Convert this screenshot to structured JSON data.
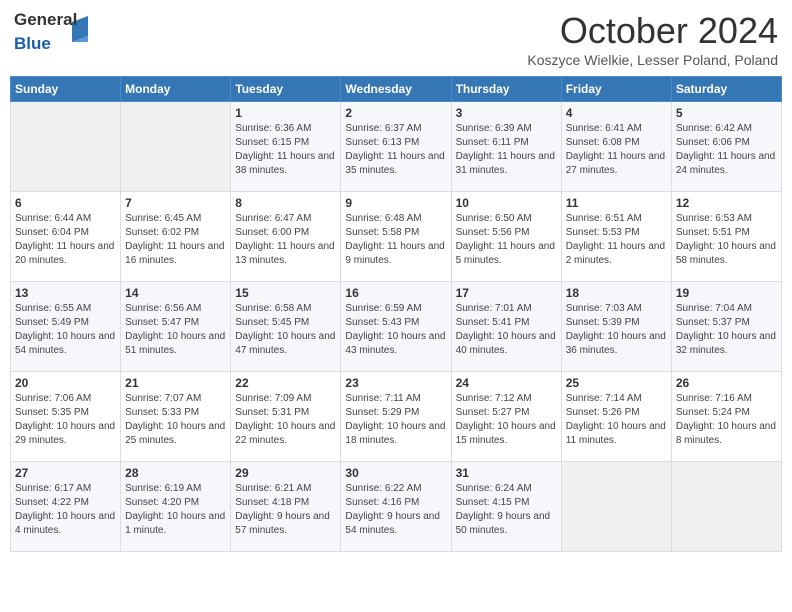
{
  "logo": {
    "general": "General",
    "blue": "Blue"
  },
  "header": {
    "month": "October 2024",
    "location": "Koszyce Wielkie, Lesser Poland, Poland"
  },
  "weekdays": [
    "Sunday",
    "Monday",
    "Tuesday",
    "Wednesday",
    "Thursday",
    "Friday",
    "Saturday"
  ],
  "weeks": [
    [
      {
        "day": "",
        "sunrise": "",
        "sunset": "",
        "daylight": ""
      },
      {
        "day": "",
        "sunrise": "",
        "sunset": "",
        "daylight": ""
      },
      {
        "day": "1",
        "sunrise": "Sunrise: 6:36 AM",
        "sunset": "Sunset: 6:15 PM",
        "daylight": "Daylight: 11 hours and 38 minutes."
      },
      {
        "day": "2",
        "sunrise": "Sunrise: 6:37 AM",
        "sunset": "Sunset: 6:13 PM",
        "daylight": "Daylight: 11 hours and 35 minutes."
      },
      {
        "day": "3",
        "sunrise": "Sunrise: 6:39 AM",
        "sunset": "Sunset: 6:11 PM",
        "daylight": "Daylight: 11 hours and 31 minutes."
      },
      {
        "day": "4",
        "sunrise": "Sunrise: 6:41 AM",
        "sunset": "Sunset: 6:08 PM",
        "daylight": "Daylight: 11 hours and 27 minutes."
      },
      {
        "day": "5",
        "sunrise": "Sunrise: 6:42 AM",
        "sunset": "Sunset: 6:06 PM",
        "daylight": "Daylight: 11 hours and 24 minutes."
      }
    ],
    [
      {
        "day": "6",
        "sunrise": "Sunrise: 6:44 AM",
        "sunset": "Sunset: 6:04 PM",
        "daylight": "Daylight: 11 hours and 20 minutes."
      },
      {
        "day": "7",
        "sunrise": "Sunrise: 6:45 AM",
        "sunset": "Sunset: 6:02 PM",
        "daylight": "Daylight: 11 hours and 16 minutes."
      },
      {
        "day": "8",
        "sunrise": "Sunrise: 6:47 AM",
        "sunset": "Sunset: 6:00 PM",
        "daylight": "Daylight: 11 hours and 13 minutes."
      },
      {
        "day": "9",
        "sunrise": "Sunrise: 6:48 AM",
        "sunset": "Sunset: 5:58 PM",
        "daylight": "Daylight: 11 hours and 9 minutes."
      },
      {
        "day": "10",
        "sunrise": "Sunrise: 6:50 AM",
        "sunset": "Sunset: 5:56 PM",
        "daylight": "Daylight: 11 hours and 5 minutes."
      },
      {
        "day": "11",
        "sunrise": "Sunrise: 6:51 AM",
        "sunset": "Sunset: 5:53 PM",
        "daylight": "Daylight: 11 hours and 2 minutes."
      },
      {
        "day": "12",
        "sunrise": "Sunrise: 6:53 AM",
        "sunset": "Sunset: 5:51 PM",
        "daylight": "Daylight: 10 hours and 58 minutes."
      }
    ],
    [
      {
        "day": "13",
        "sunrise": "Sunrise: 6:55 AM",
        "sunset": "Sunset: 5:49 PM",
        "daylight": "Daylight: 10 hours and 54 minutes."
      },
      {
        "day": "14",
        "sunrise": "Sunrise: 6:56 AM",
        "sunset": "Sunset: 5:47 PM",
        "daylight": "Daylight: 10 hours and 51 minutes."
      },
      {
        "day": "15",
        "sunrise": "Sunrise: 6:58 AM",
        "sunset": "Sunset: 5:45 PM",
        "daylight": "Daylight: 10 hours and 47 minutes."
      },
      {
        "day": "16",
        "sunrise": "Sunrise: 6:59 AM",
        "sunset": "Sunset: 5:43 PM",
        "daylight": "Daylight: 10 hours and 43 minutes."
      },
      {
        "day": "17",
        "sunrise": "Sunrise: 7:01 AM",
        "sunset": "Sunset: 5:41 PM",
        "daylight": "Daylight: 10 hours and 40 minutes."
      },
      {
        "day": "18",
        "sunrise": "Sunrise: 7:03 AM",
        "sunset": "Sunset: 5:39 PM",
        "daylight": "Daylight: 10 hours and 36 minutes."
      },
      {
        "day": "19",
        "sunrise": "Sunrise: 7:04 AM",
        "sunset": "Sunset: 5:37 PM",
        "daylight": "Daylight: 10 hours and 32 minutes."
      }
    ],
    [
      {
        "day": "20",
        "sunrise": "Sunrise: 7:06 AM",
        "sunset": "Sunset: 5:35 PM",
        "daylight": "Daylight: 10 hours and 29 minutes."
      },
      {
        "day": "21",
        "sunrise": "Sunrise: 7:07 AM",
        "sunset": "Sunset: 5:33 PM",
        "daylight": "Daylight: 10 hours and 25 minutes."
      },
      {
        "day": "22",
        "sunrise": "Sunrise: 7:09 AM",
        "sunset": "Sunset: 5:31 PM",
        "daylight": "Daylight: 10 hours and 22 minutes."
      },
      {
        "day": "23",
        "sunrise": "Sunrise: 7:11 AM",
        "sunset": "Sunset: 5:29 PM",
        "daylight": "Daylight: 10 hours and 18 minutes."
      },
      {
        "day": "24",
        "sunrise": "Sunrise: 7:12 AM",
        "sunset": "Sunset: 5:27 PM",
        "daylight": "Daylight: 10 hours and 15 minutes."
      },
      {
        "day": "25",
        "sunrise": "Sunrise: 7:14 AM",
        "sunset": "Sunset: 5:26 PM",
        "daylight": "Daylight: 10 hours and 11 minutes."
      },
      {
        "day": "26",
        "sunrise": "Sunrise: 7:16 AM",
        "sunset": "Sunset: 5:24 PM",
        "daylight": "Daylight: 10 hours and 8 minutes."
      }
    ],
    [
      {
        "day": "27",
        "sunrise": "Sunrise: 6:17 AM",
        "sunset": "Sunset: 4:22 PM",
        "daylight": "Daylight: 10 hours and 4 minutes."
      },
      {
        "day": "28",
        "sunrise": "Sunrise: 6:19 AM",
        "sunset": "Sunset: 4:20 PM",
        "daylight": "Daylight: 10 hours and 1 minute."
      },
      {
        "day": "29",
        "sunrise": "Sunrise: 6:21 AM",
        "sunset": "Sunset: 4:18 PM",
        "daylight": "Daylight: 9 hours and 57 minutes."
      },
      {
        "day": "30",
        "sunrise": "Sunrise: 6:22 AM",
        "sunset": "Sunset: 4:16 PM",
        "daylight": "Daylight: 9 hours and 54 minutes."
      },
      {
        "day": "31",
        "sunrise": "Sunrise: 6:24 AM",
        "sunset": "Sunset: 4:15 PM",
        "daylight": "Daylight: 9 hours and 50 minutes."
      },
      {
        "day": "",
        "sunrise": "",
        "sunset": "",
        "daylight": ""
      },
      {
        "day": "",
        "sunrise": "",
        "sunset": "",
        "daylight": ""
      }
    ]
  ]
}
